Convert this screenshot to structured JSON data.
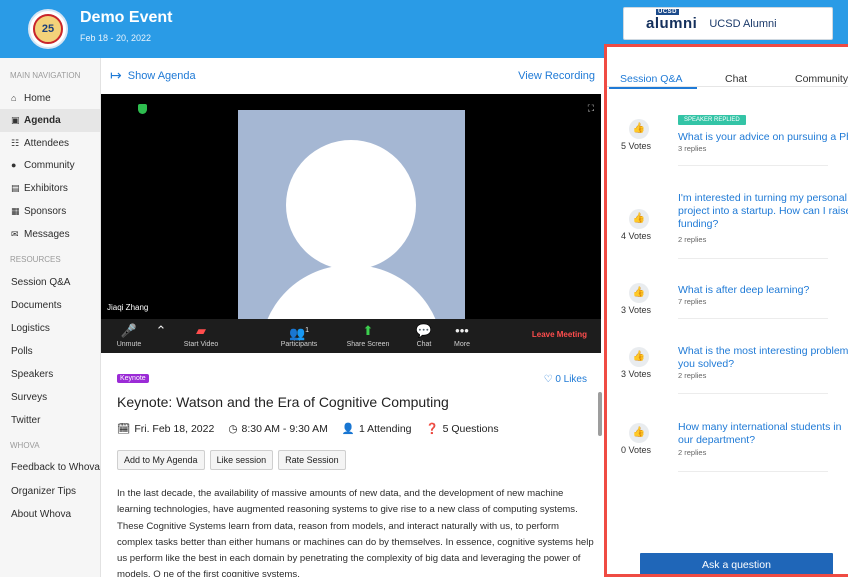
{
  "header": {
    "logo_text": "25",
    "event_title": "Demo Event",
    "event_dates": "Feb 18 - 20, 2022",
    "sponsor_logo_tag": "UCSD",
    "sponsor_logo": "alumni",
    "sponsor_name": "UCSD Alumni",
    "accent": "#2a9be6"
  },
  "sidebar": {
    "sections": [
      "MAIN NAVIGATION",
      "RESOURCES",
      "WHOVA"
    ],
    "main_items": [
      {
        "label": "Home",
        "icon": "home-icon",
        "glyph": "⌂"
      },
      {
        "label": "Agenda",
        "icon": "calendar-icon",
        "glyph": "▣"
      },
      {
        "label": "Attendees",
        "icon": "users-icon",
        "glyph": "☷"
      },
      {
        "label": "Community",
        "icon": "chat-icon",
        "glyph": "●"
      },
      {
        "label": "Exhibitors",
        "icon": "building-icon",
        "glyph": "▤"
      },
      {
        "label": "Sponsors",
        "icon": "sponsor-icon",
        "glyph": "▦"
      },
      {
        "label": "Messages",
        "icon": "mail-icon",
        "glyph": "✉"
      }
    ],
    "resource_items": [
      "Session Q&A",
      "Documents",
      "Logistics",
      "Polls",
      "Speakers",
      "Surveys",
      "Twitter"
    ],
    "whova_items": [
      "Feedback to Whova",
      "Organizer Tips",
      "About Whova"
    ]
  },
  "content": {
    "show_agenda": "Show Agenda",
    "view_recording": "View Recording",
    "video": {
      "speaker_name": "Jiaqi Zhang",
      "toolbar": [
        {
          "label": "Unmute",
          "icon": "mic-muted-icon",
          "glyph": "✎"
        },
        {
          "label": "Start Video",
          "icon": "video-off-icon",
          "glyph": "▰"
        },
        {
          "label": "Participants",
          "icon": "participants-icon",
          "glyph": "👥",
          "count": "1"
        },
        {
          "label": "Share Screen",
          "icon": "share-screen-icon",
          "glyph": "⬆"
        },
        {
          "label": "Chat",
          "icon": "chat-bubble-icon",
          "glyph": "…"
        },
        {
          "label": "More",
          "icon": "more-icon",
          "glyph": "•••"
        }
      ],
      "leave": "Leave Meeting"
    },
    "session": {
      "badge": "Keynote",
      "likes": "0 Likes",
      "title": "Keynote: Watson and the Era of Cognitive Computing",
      "date": "Fri. Feb 18, 2022",
      "time": "8:30 AM - 9:30 AM",
      "attending": "1 Attending",
      "questions": "5 Questions",
      "buttons": [
        "Add to My Agenda",
        "Like session",
        "Rate Session"
      ],
      "description": "In the last decade, the availability of massive amounts of new data, and the development of new machine learning technologies, have augmented reasoning systems to give rise to a new class of computing systems. These Cognitive Systems learn from data, reason from models, and interact naturally with us, to perform complex tasks better than either humans or machines can do by themselves. In essence, cognitive systems help us perform like the best in each domain by penetrating the complexity of big data and leveraging the power of models. O ne of the first cognitive systems,"
    }
  },
  "panel": {
    "tabs": [
      "Session Q&A",
      "Chat",
      "Community"
    ],
    "speaker_replied": "SPEAKER REPLIED",
    "questions": [
      {
        "votes": "5 Votes",
        "text": "What is your advice on pursuing a PhD",
        "replies": "3 replies"
      },
      {
        "votes": "4 Votes",
        "text": "I'm interested in turning my personal project into a startup. How can I raise funding?",
        "replies": "2 replies"
      },
      {
        "votes": "3 Votes",
        "text": "What is after deep learning?",
        "replies": "7 replies"
      },
      {
        "votes": "3 Votes",
        "text": "What is the most interesting problem you solved?",
        "replies": "2 replies"
      },
      {
        "votes": "0 Votes",
        "text": "How many international students in our department?",
        "replies": "2 replies"
      }
    ],
    "ask_button": "Ask a question",
    "highlight_color": "#ef4b43"
  }
}
